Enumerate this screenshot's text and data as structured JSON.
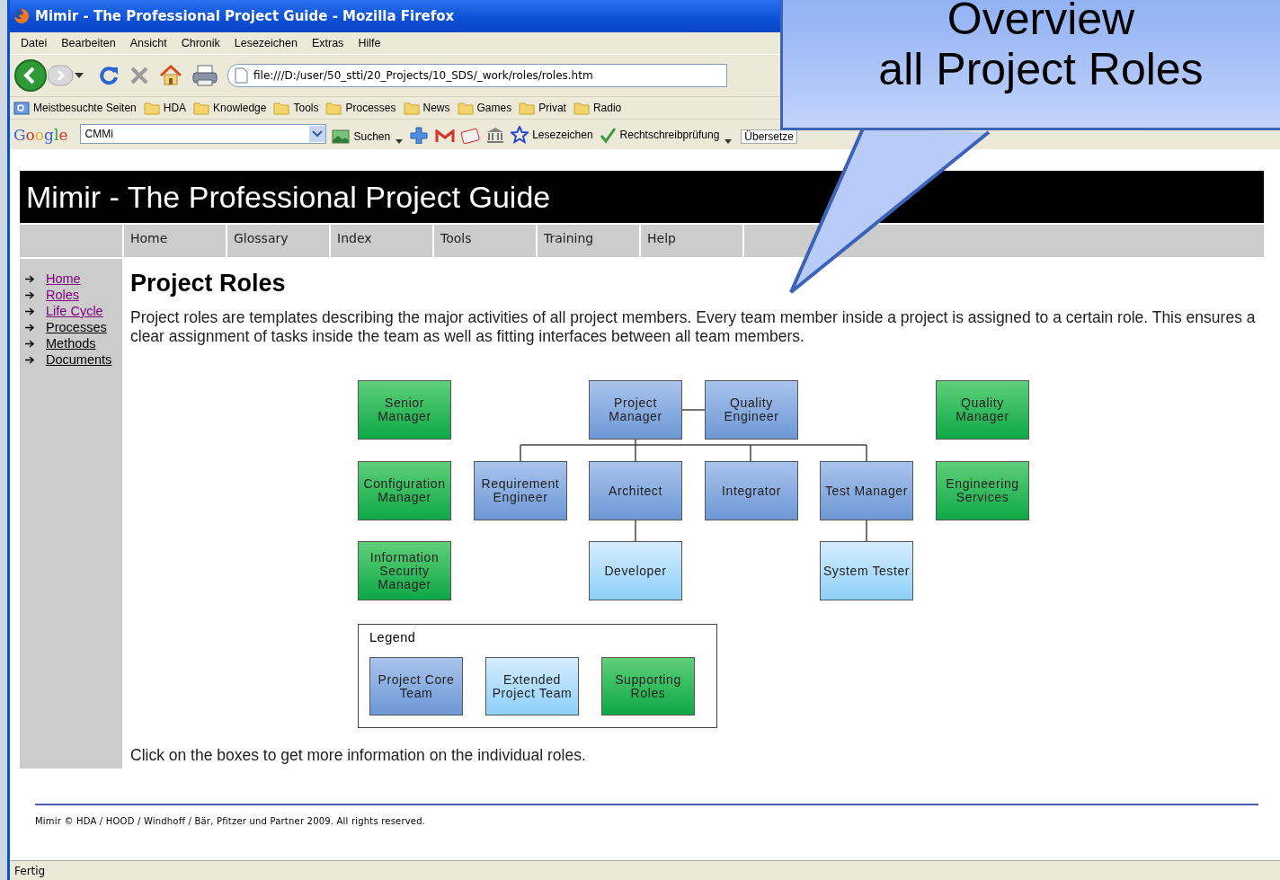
{
  "window": {
    "title": "Mimir - The Professional Project Guide - Mozilla Firefox"
  },
  "menu": [
    "Datei",
    "Bearbeiten",
    "Ansicht",
    "Chronik",
    "Lesezeichen",
    "Extras",
    "Hilfe"
  ],
  "address": {
    "value": "file:///D:/user/50_stti/20_Projects/10_SDS/_work/roles/roles.htm"
  },
  "bookmarks": [
    {
      "label": "Meistbesuchte Seiten",
      "kind": "smart"
    },
    {
      "label": "HDA",
      "kind": "folder"
    },
    {
      "label": "Knowledge",
      "kind": "folder"
    },
    {
      "label": "Tools",
      "kind": "folder"
    },
    {
      "label": "Processes",
      "kind": "folder"
    },
    {
      "label": "News",
      "kind": "folder"
    },
    {
      "label": "Games",
      "kind": "folder"
    },
    {
      "label": "Privat",
      "kind": "folder"
    },
    {
      "label": "Radio",
      "kind": "folder"
    }
  ],
  "google_toolbar": {
    "logo": "Google",
    "search": "CMMi",
    "search_button": "Suchen",
    "bookmarks_button": "Lesezeichen",
    "spell_button": "Rechtschreibprüfung",
    "translate_button": "Übersetze"
  },
  "page": {
    "header_title": "Mimir - The Professional Project Guide",
    "nav": [
      "Home",
      "Glossary",
      "Index",
      "Tools",
      "Training",
      "Help"
    ],
    "sidebar": [
      {
        "label": "Home",
        "visited": true
      },
      {
        "label": "Roles",
        "visited": true
      },
      {
        "label": "Life Cycle",
        "visited": true
      },
      {
        "label": "Processes",
        "visited": false
      },
      {
        "label": "Methods",
        "visited": false
      },
      {
        "label": "Documents",
        "visited": false
      }
    ],
    "heading": "Project Roles",
    "intro": "Project roles are templates describing the major activities of all project members. Every team member inside a project is assigned to a certain role. This ensures a clear assignment of tasks inside the team as well as fitting interfaces between all team members.",
    "roles": [
      {
        "label": "Senior\nManager",
        "kind": "support"
      },
      {
        "label": "Project\nManager",
        "kind": "core"
      },
      {
        "label": "Quality\nEngineer",
        "kind": "core"
      },
      {
        "label": "Quality\nManager",
        "kind": "support"
      },
      {
        "label": "Configuration\nManager",
        "kind": "support"
      },
      {
        "label": "Requirement\nEngineer",
        "kind": "core"
      },
      {
        "label": "Architect",
        "kind": "core"
      },
      {
        "label": "Integrator",
        "kind": "core"
      },
      {
        "label": "Test Manager",
        "kind": "core"
      },
      {
        "label": "Engineering\nServices",
        "kind": "support"
      },
      {
        "label": "Information\nSecurity\nManager",
        "kind": "support"
      },
      {
        "label": "Developer",
        "kind": "extended"
      },
      {
        "label": "System Tester",
        "kind": "extended"
      }
    ],
    "legend": {
      "title": "Legend",
      "items": [
        {
          "label": "Project Core\nTeam",
          "kind": "core"
        },
        {
          "label": "Extended\nProject Team",
          "kind": "extended"
        },
        {
          "label": "Supporting\nRoles",
          "kind": "support"
        }
      ]
    },
    "note": "Click on the boxes to get more information on the individual roles.",
    "footer": "Mimir © HDA / HOOD / Windhoff / Bär, Pfitzer und Partner 2009. All rights reserved."
  },
  "status_bar": "Fertig",
  "callout": {
    "lines": [
      "Overview",
      "all Project Roles"
    ]
  }
}
